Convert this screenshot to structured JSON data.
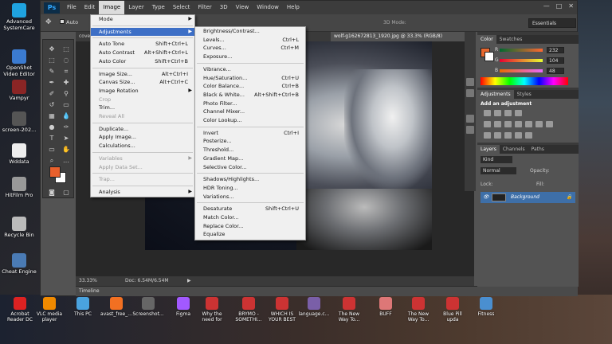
{
  "desktop_left": [
    {
      "label": "Advanced SystemCare",
      "icon": "advanced-systemcare-icon",
      "color": "#1fa3e0"
    },
    {
      "label": "OpenShot Video Editor",
      "icon": "openshot-icon",
      "color": "#3b7bd1"
    },
    {
      "label": "Vampyr",
      "icon": "vampyr-icon",
      "color": "#8a2525"
    },
    {
      "label": "screen-202...",
      "icon": "screen-file-icon",
      "color": "#555555"
    },
    {
      "label": "Wddata",
      "icon": "wddata-icon",
      "color": "#eeeeee"
    },
    {
      "label": "HitFilm Pro",
      "icon": "hitfilm-icon",
      "color": "#999999"
    },
    {
      "label": "Recycle Bin",
      "icon": "recycle-bin-icon",
      "color": "#bbbbbb"
    },
    {
      "label": "Cheat Engine",
      "icon": "cheat-engine-icon",
      "color": "#4a7bb5"
    }
  ],
  "taskbar_icons": [
    {
      "label": "Acrobat Reader DC",
      "icon": "acrobat-icon",
      "color": "#d22"
    },
    {
      "label": "VLC media player",
      "icon": "vlc-icon",
      "color": "#f08a00"
    },
    {
      "label": "This PC",
      "icon": "this-pc-icon",
      "color": "#4aa3df"
    },
    {
      "label": "avast_free_...",
      "icon": "avast-icon",
      "color": "#f27022"
    },
    {
      "label": "Screenshot...",
      "icon": "screenshot-icon",
      "color": "#666"
    },
    {
      "label": "Figma",
      "icon": "figma-icon",
      "color": "#a259ff"
    },
    {
      "label": "Why the need for",
      "icon": "doc-icon",
      "color": "#c33"
    },
    {
      "label": "BRYMO - SOMETHI...",
      "icon": "doc-icon",
      "color": "#c33"
    },
    {
      "label": "WHICH IS YOUR BEST",
      "icon": "doc-icon",
      "color": "#c33"
    },
    {
      "label": "language.c...",
      "icon": "language-icon",
      "color": "#7a5fa8"
    },
    {
      "label": "The New Way To...",
      "icon": "doc-icon",
      "color": "#c33"
    },
    {
      "label": "BUFF",
      "icon": "buff-icon",
      "color": "#d77"
    },
    {
      "label": "The New Way To...",
      "icon": "doc-icon",
      "color": "#c33"
    },
    {
      "label": "Blue Pill upda",
      "icon": "doc-icon",
      "color": "#c33"
    },
    {
      "label": "Fitness",
      "icon": "fitness-icon",
      "color": "#4a8fd0"
    }
  ],
  "app": {
    "logo": "Ps",
    "menu": [
      "File",
      "Edit",
      "Image",
      "Layer",
      "Type",
      "Select",
      "Filter",
      "3D",
      "View",
      "Window",
      "Help"
    ],
    "active_menu": "Image",
    "window_controls": [
      "—",
      "□",
      "✕"
    ]
  },
  "options_bar": {
    "auto_select": "Auto",
    "mode_label": "3D Mode:",
    "workspace": "Essentials"
  },
  "document": {
    "tab_left": "coverd",
    "tab_active": "wolf-g162672813_1920.jpg @ 33.3% (RGB/8)",
    "zoom": "33.33%",
    "doc_size": "Doc: 6.54M/6.54M"
  },
  "timeline_label": "Timeline",
  "image_menu": {
    "items": [
      {
        "label": "Mode",
        "shortcut": "",
        "submenu": true,
        "disabled": false
      },
      {
        "sep": true
      },
      {
        "label": "Adjustments",
        "shortcut": "",
        "submenu": true,
        "disabled": false,
        "highlight": true
      },
      {
        "sep": true
      },
      {
        "label": "Auto Tone",
        "shortcut": "Shift+Ctrl+L",
        "submenu": false,
        "disabled": false
      },
      {
        "label": "Auto Contrast",
        "shortcut": "Alt+Shift+Ctrl+L",
        "submenu": false,
        "disabled": false
      },
      {
        "label": "Auto Color",
        "shortcut": "Shift+Ctrl+B",
        "submenu": false,
        "disabled": false
      },
      {
        "sep": true
      },
      {
        "label": "Image Size...",
        "shortcut": "Alt+Ctrl+I",
        "submenu": false,
        "disabled": false
      },
      {
        "label": "Canvas Size...",
        "shortcut": "Alt+Ctrl+C",
        "submenu": false,
        "disabled": false
      },
      {
        "label": "Image Rotation",
        "shortcut": "",
        "submenu": true,
        "disabled": false
      },
      {
        "label": "Crop",
        "shortcut": "",
        "submenu": false,
        "disabled": true
      },
      {
        "label": "Trim...",
        "shortcut": "",
        "submenu": false,
        "disabled": false
      },
      {
        "label": "Reveal All",
        "shortcut": "",
        "submenu": false,
        "disabled": true
      },
      {
        "sep": true
      },
      {
        "label": "Duplicate...",
        "shortcut": "",
        "submenu": false,
        "disabled": false
      },
      {
        "label": "Apply Image...",
        "shortcut": "",
        "submenu": false,
        "disabled": false
      },
      {
        "label": "Calculations...",
        "shortcut": "",
        "submenu": false,
        "disabled": false
      },
      {
        "sep": true
      },
      {
        "label": "Variables",
        "shortcut": "",
        "submenu": true,
        "disabled": true
      },
      {
        "label": "Apply Data Set...",
        "shortcut": "",
        "submenu": false,
        "disabled": true
      },
      {
        "sep": true
      },
      {
        "label": "Trap...",
        "shortcut": "",
        "submenu": false,
        "disabled": true
      },
      {
        "sep": true
      },
      {
        "label": "Analysis",
        "shortcut": "",
        "submenu": true,
        "disabled": false
      }
    ]
  },
  "adjustments_menu": {
    "items": [
      {
        "label": "Brightness/Contrast...",
        "shortcut": ""
      },
      {
        "label": "Levels...",
        "shortcut": "Ctrl+L"
      },
      {
        "label": "Curves...",
        "shortcut": "Ctrl+M"
      },
      {
        "label": "Exposure...",
        "shortcut": ""
      },
      {
        "sep": true
      },
      {
        "label": "Vibrance...",
        "shortcut": ""
      },
      {
        "label": "Hue/Saturation...",
        "shortcut": "Ctrl+U"
      },
      {
        "label": "Color Balance...",
        "shortcut": "Ctrl+B"
      },
      {
        "label": "Black & White...",
        "shortcut": "Alt+Shift+Ctrl+B"
      },
      {
        "label": "Photo Filter...",
        "shortcut": ""
      },
      {
        "label": "Channel Mixer...",
        "shortcut": ""
      },
      {
        "label": "Color Lookup...",
        "shortcut": ""
      },
      {
        "sep": true
      },
      {
        "label": "Invert",
        "shortcut": "Ctrl+I"
      },
      {
        "label": "Posterize...",
        "shortcut": ""
      },
      {
        "label": "Threshold...",
        "shortcut": ""
      },
      {
        "label": "Gradient Map...",
        "shortcut": ""
      },
      {
        "label": "Selective Color...",
        "shortcut": ""
      },
      {
        "sep": true
      },
      {
        "label": "Shadows/Highlights...",
        "shortcut": ""
      },
      {
        "label": "HDR Toning...",
        "shortcut": ""
      },
      {
        "label": "Variations...",
        "shortcut": ""
      },
      {
        "sep": true
      },
      {
        "label": "Desaturate",
        "shortcut": "Shift+Ctrl+U"
      },
      {
        "label": "Match Color...",
        "shortcut": ""
      },
      {
        "label": "Replace Color...",
        "shortcut": ""
      },
      {
        "label": "Equalize",
        "shortcut": ""
      }
    ]
  },
  "color_panel": {
    "tabs": [
      "Color",
      "Swatches"
    ],
    "r_label": "R",
    "g_label": "G",
    "b_label": "B",
    "r": "232",
    "g": "104",
    "b": "48",
    "fg_color": "#e8682f"
  },
  "adjustments_panel": {
    "tabs": [
      "Adjustments",
      "Styles"
    ],
    "title": "Add an adjustment"
  },
  "layers_panel": {
    "tabs": [
      "Layers",
      "Channels",
      "Paths"
    ],
    "kind": "Kind",
    "blend": "Normal",
    "opacity_label": "Opacity:",
    "lock_label": "Lock:",
    "fill_label": "Fill:",
    "layer_name": "Background"
  }
}
